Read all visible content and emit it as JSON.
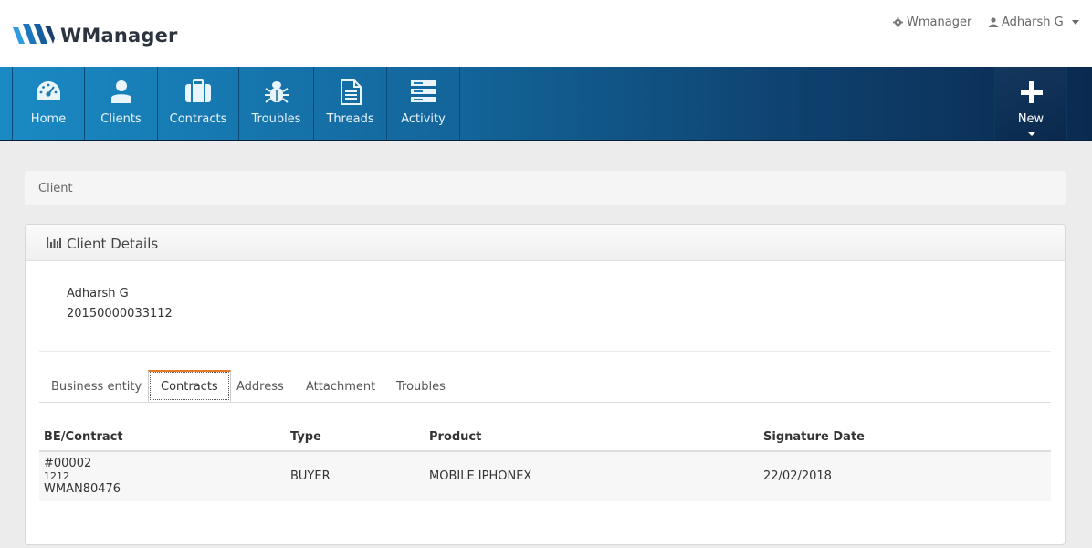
{
  "header": {
    "logo_text": "WManager",
    "app_link": "Wmanager",
    "user_name": "Adharsh G"
  },
  "nav": {
    "items": [
      {
        "label": "Home",
        "icon": "dashboard-icon"
      },
      {
        "label": "Clients",
        "icon": "user-icon"
      },
      {
        "label": "Contracts",
        "icon": "briefcase-icon"
      },
      {
        "label": "Troubles",
        "icon": "bug-icon"
      },
      {
        "label": "Threads",
        "icon": "document-icon"
      },
      {
        "label": "Activity",
        "icon": "server-icon"
      }
    ],
    "new_label": "New"
  },
  "breadcrumb": {
    "current": "Client"
  },
  "panel": {
    "title": "Client Details",
    "client_name": "Adharsh G",
    "client_id": "20150000033112"
  },
  "tabs": [
    {
      "label": "Business entity",
      "active": false
    },
    {
      "label": "Contracts",
      "active": true
    },
    {
      "label": "Address",
      "active": false
    },
    {
      "label": "Attachment",
      "active": false
    },
    {
      "label": "Troubles",
      "active": false
    }
  ],
  "table": {
    "headers": [
      "BE/Contract",
      "Type",
      "Product",
      "Signature Date"
    ],
    "rows": [
      {
        "be_line1": "#00002",
        "be_line2": "1212",
        "be_line3": "WMAN80476",
        "type": "BUYER",
        "product": "MOBILE IPHONEX",
        "signature_date": "22/02/2018"
      }
    ]
  },
  "colors": {
    "nav_start": "#1a8ac4",
    "nav_end": "#0b2a50",
    "active_tab_accent": "#e07a2c"
  }
}
